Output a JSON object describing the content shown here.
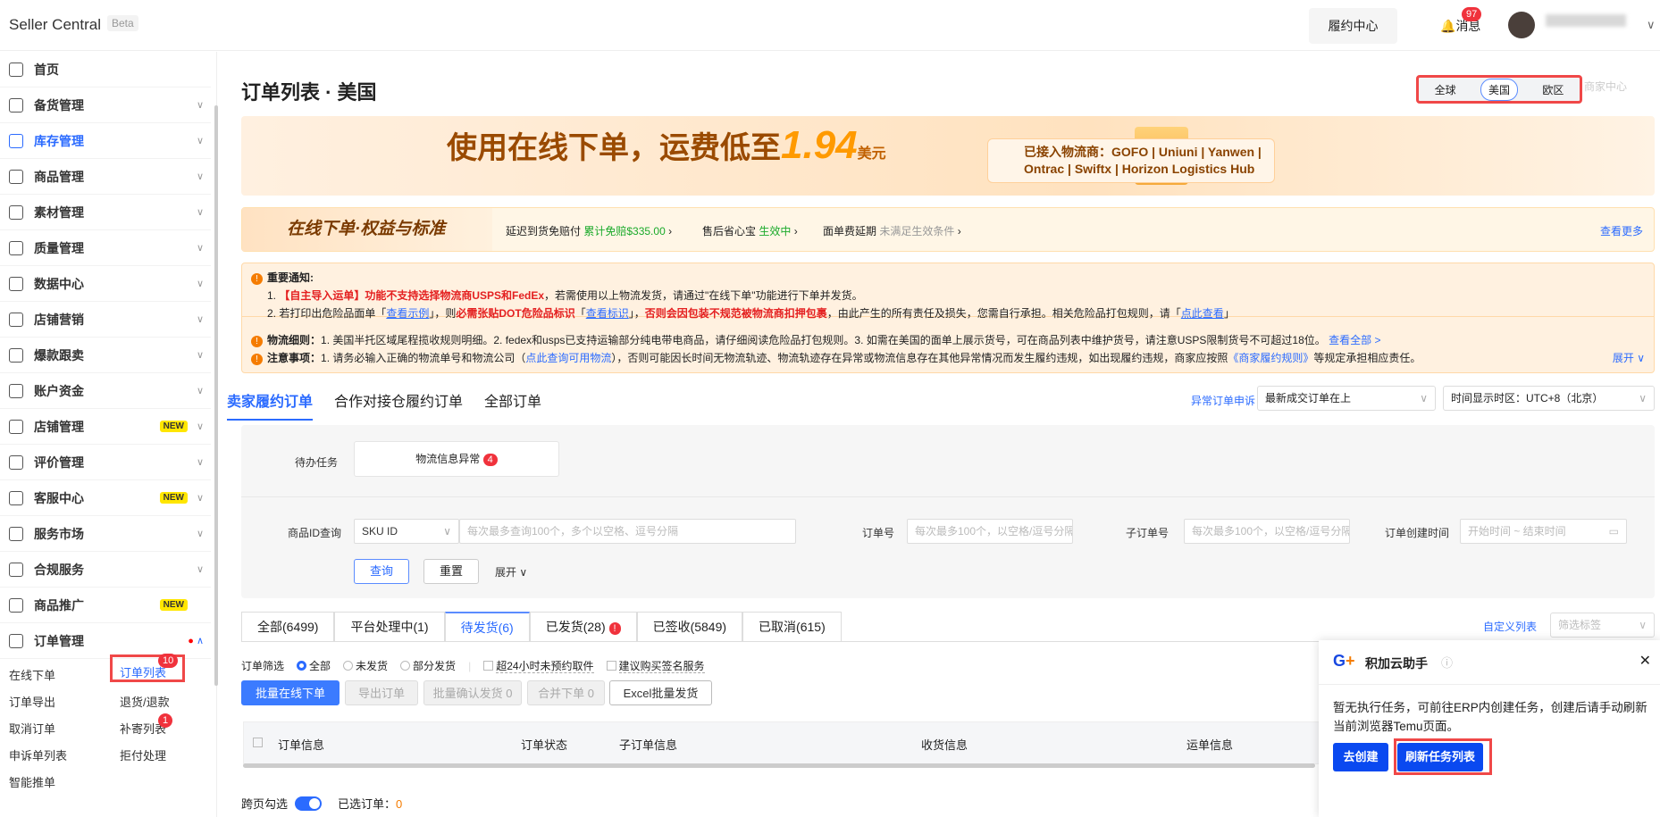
{
  "header": {
    "brand": "Seller Central",
    "beta": "Beta",
    "fulfillment": "履约中心",
    "messages": "消息",
    "message_count": "97"
  },
  "sidebar": {
    "items": [
      {
        "label": "首页"
      },
      {
        "label": "备货管理"
      },
      {
        "label": "库存管理"
      },
      {
        "label": "商品管理"
      },
      {
        "label": "素材管理"
      },
      {
        "label": "质量管理"
      },
      {
        "label": "数据中心"
      },
      {
        "label": "店铺营销"
      },
      {
        "label": "爆款跟卖"
      },
      {
        "label": "账户资金"
      },
      {
        "label": "店铺管理",
        "badge": "NEW"
      },
      {
        "label": "评价管理"
      },
      {
        "label": "客服中心",
        "badge": "NEW"
      },
      {
        "label": "服务市场"
      },
      {
        "label": "合规服务"
      },
      {
        "label": "商品推广",
        "badge": "NEW"
      },
      {
        "label": "订单管理"
      }
    ],
    "sub": {
      "online": "在线下单",
      "list": "订单列表",
      "list_badge": "10",
      "export": "订单导出",
      "refund": "退货/退款",
      "cancel": "取消订单",
      "resend": "补寄列表",
      "resend_badge": "1",
      "appeal": "申诉单列表",
      "chargeback": "拒付处理",
      "smart": "智能推单"
    }
  },
  "page": {
    "title": "订单列表 · 美国",
    "regions": [
      "全球",
      "美国",
      "欧区"
    ],
    "merchant": "商家中心"
  },
  "banner1": {
    "text": "使用在线下单，运费低至",
    "price": "1.94",
    "unit": "美元",
    "carriers_line1": "已接入物流商：GOFO | Uniuni | Yanwen |",
    "carriers_line2": "Ontrac | Swiftx | Horizon Logistics Hub"
  },
  "banner2": {
    "title": "在线下单·权益与标准",
    "i1": "延迟到货免赔付",
    "i1v": "累计免赔$335.00",
    "i2": "售后省心宝",
    "i2v": "生效中",
    "i3": "面单费延期",
    "i3v": "未满足生效条件",
    "more": "查看更多"
  },
  "notice": {
    "title": "重要通知:",
    "l1a": "1. ",
    "l1b": "【自主导入运单】功能不支持选择物流商USPS和FedEx",
    "l1c": "，若需使用以上物流发货，请通过\"在线下单\"功能进行下单并发货。",
    "l2a": "2. 若打印出危险品面单「",
    "l2b": "查看示例",
    "l2c": "」，则",
    "l2d": "必需张贴DOT危险品标识",
    "l2e": "「",
    "l2f": "查看标识",
    "l2g": "」，",
    "l2h": "否则会因包装不规范被物流商扣押包裹",
    "l2i": "，由此产生的所有责任及损失，您需自行承担。相关危险品打包规则，请「",
    "l2j": "点此查看",
    "l2k": "」",
    "l3a": "物流细则：",
    "l3b": "1. 美国半托区域尾程揽收规则明细。2. fedex和usps已支持运输部分纯电带电商品，请仔细阅读危险品打包规则。3. 如需在美国的面单上展示货号，可在商品列表中维护货号，请注意USPS限制货号不可超过18位。",
    "l3c": "查看全部 >",
    "l4a": "注意事项：",
    "l4b": "1. 请务必输入正确的物流单号和物流公司（",
    "l4c": "点此查询可用物流",
    "l4d": "），否则可能因长时间无物流轨迹、物流轨迹存在异常或物流信息存在其他异常情况而发生履约违规，如出现履约违规，商家应按照",
    "l4e": "《商家履约规则》",
    "l4f": "等规定承担相应责任。",
    "expand": "展开 ∨"
  },
  "tabs": [
    "卖家履约订单",
    "合作对接仓履约订单",
    "全部订单"
  ],
  "toolbar": {
    "appeal": "异常订单申诉",
    "sort": "最新成交订单在上",
    "timezone": "时间显示时区：UTC+8（北京）"
  },
  "filter": {
    "todo_label": "待办任务",
    "todo_item": "物流信息异常",
    "todo_count": "4",
    "pid_label": "商品ID查询",
    "pid_type": "SKU ID",
    "pid_ph": "每次最多查询100个，多个以空格、逗号分隔",
    "order_label": "订单号",
    "order_ph": "每次最多100个，以空格/逗号分隔",
    "sub_label": "子订单号",
    "sub_ph": "每次最多100个，以空格/逗号分隔",
    "time_label": "订单创建时间",
    "time_ph": "开始时间  ~  结束时间",
    "query": "查询",
    "reset": "重置",
    "expand": "展开 ∨"
  },
  "status_tabs": [
    "全部(6499)",
    "平台处理中(1)",
    "待发货(6)",
    "已发货(28)",
    "已签收(5849)",
    "已取消(615)"
  ],
  "custom": {
    "label": "自定义列表",
    "tag_ph": "筛选标签"
  },
  "order_filter": {
    "label": "订单筛选",
    "r1": "全部",
    "r2": "未发货",
    "r3": "部分发货",
    "c1": "超24小时未预约取件",
    "c2": "建议购买签名服务"
  },
  "actions": [
    "批量在线下单",
    "导出订单",
    "批量确认发货 0",
    "合并下单 0",
    "Excel批量发货"
  ],
  "table": {
    "cols": [
      "订单信息",
      "订单状态",
      "子订单信息",
      "收货信息",
      "运单信息"
    ]
  },
  "bottom": {
    "cross": "跨页勾选",
    "selected": "已选订单：",
    "count": "0"
  },
  "popup": {
    "title": "积加云助手",
    "body": "暂无执行任务，可前往ERP内创建任务，创建后请手动刷新当前浏览器Temu页面。",
    "create": "去创建",
    "refresh": "刷新任务列表"
  }
}
